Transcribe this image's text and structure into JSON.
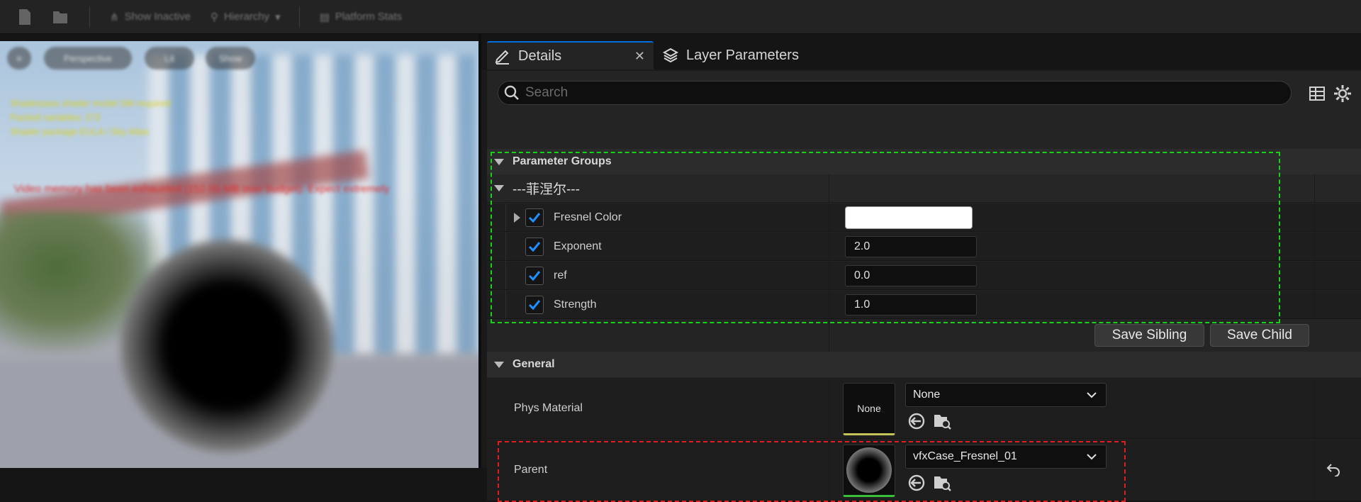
{
  "toolbar": {
    "show_inactive": "Show Inactive",
    "hierarchy": "Hierarchy",
    "platform_stats": "Platform Stats"
  },
  "viewport": {
    "buttons": [
      "Perspective",
      "Lit",
      "Show"
    ],
    "overlay_lines": [
      "Shaderpass shader model SM required",
      "Packed variables: 272",
      "Shader package EULA / Sky Atlas"
    ],
    "warning": "Video memory has been exhausted (152.00 MB over budget). Expect extremely"
  },
  "tabs": [
    {
      "label": "Details",
      "icon": "pencil-icon",
      "active": true
    },
    {
      "label": "Layer Parameters",
      "icon": "layers-icon",
      "active": false
    }
  ],
  "search": {
    "placeholder": "Search",
    "value": ""
  },
  "parameter_groups": {
    "title": "Parameter Groups",
    "group_name": "---菲涅尔---",
    "params": [
      {
        "name": "Fresnel Color",
        "checked": true,
        "type": "color",
        "value": "#ffffff"
      },
      {
        "name": "Exponent",
        "checked": true,
        "type": "number",
        "value": "2.0"
      },
      {
        "name": "ref",
        "checked": true,
        "type": "number",
        "value": "0.0"
      },
      {
        "name": "Strength",
        "checked": true,
        "type": "number",
        "value": "1.0"
      }
    ],
    "save_sibling": "Save Sibling",
    "save_child": "Save Child"
  },
  "general": {
    "title": "General",
    "phys_material": {
      "label": "Phys Material",
      "thumb_text": "None",
      "combo_value": "None"
    },
    "parent": {
      "label": "Parent",
      "combo_value": "vfxCase_Fresnel_01"
    }
  },
  "colors": {
    "accent": "#0070e0",
    "highlight_green": "#17d217",
    "highlight_red": "#e01e1e"
  }
}
